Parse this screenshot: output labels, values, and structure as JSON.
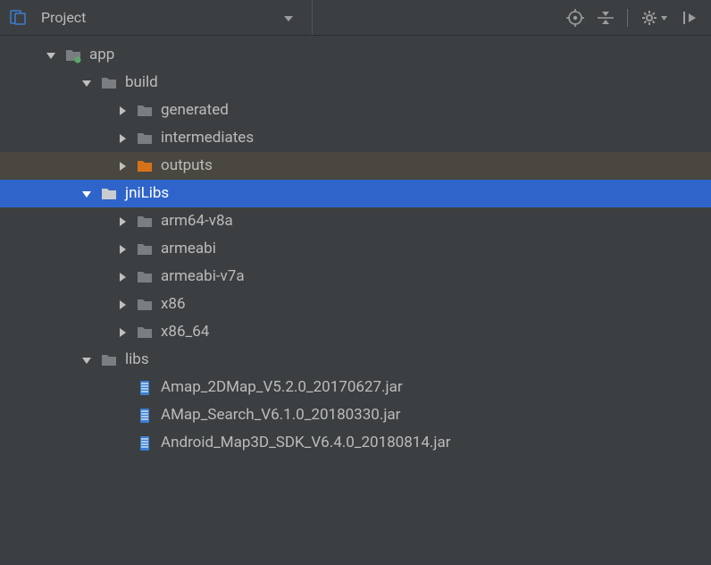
{
  "toolbar": {
    "title": "Project"
  },
  "tree": {
    "app": "app",
    "build": "build",
    "generated": "generated",
    "intermediates": "intermediates",
    "outputs": "outputs",
    "jniLibs": "jniLibs",
    "arm64v8a": "arm64-v8a",
    "armeabi": "armeabi",
    "armeabiv7a": "armeabi-v7a",
    "x86": "x86",
    "x86_64": "x86_64",
    "libs": "libs",
    "jar1": "Amap_2DMap_V5.2.0_20170627.jar",
    "jar2": "AMap_Search_V6.1.0_20180330.jar",
    "jar3": "Android_Map3D_SDK_V6.4.0_20180814.jar"
  }
}
